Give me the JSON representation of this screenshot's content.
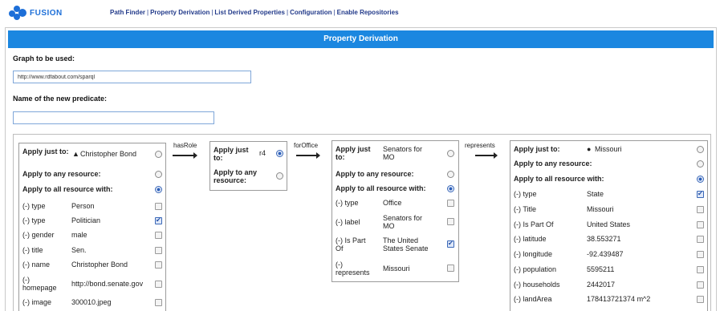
{
  "app": {
    "name": "FUSION",
    "nav": [
      {
        "label": "Path Finder"
      },
      {
        "label": "Property Derivation"
      },
      {
        "label": "List Derived Properties"
      },
      {
        "label": "Configuration"
      },
      {
        "label": "Enable Repositories"
      }
    ],
    "nav_separator": "|",
    "colors": {
      "brand": "#1d6fd8",
      "title_bar": "#1b87e0",
      "nav_link": "#223a8a"
    }
  },
  "panel": {
    "title": "Property Derivation",
    "graph_label": "Graph to be used:",
    "graph_value": "http://www.rdfabout.com/sparql",
    "predicate_label": "Name of the new predicate:",
    "predicate_value": "",
    "predicate_placeholder": ""
  },
  "path": {
    "edges": [
      {
        "label": "hasRole"
      },
      {
        "label": "forOffice"
      },
      {
        "label": "represents"
      }
    ],
    "nodes": [
      {
        "apply_just_label": "Apply just to:",
        "apply_just_value": "Christopher Bond",
        "apply_just_icon": "triangle-icon",
        "apply_any_label": "Apply to any resource:",
        "apply_all_label": "Apply to all resource with:",
        "selected": "all",
        "properties": [
          {
            "key": "(-) type",
            "value": "Person",
            "checked": false
          },
          {
            "key": "(-) type",
            "value": "Politician",
            "checked": true
          },
          {
            "key": "(-) gender",
            "value": "male",
            "checked": false
          },
          {
            "key": "(-) title",
            "value": "Sen.",
            "checked": false
          },
          {
            "key": "(-) name",
            "value": "Christopher Bond",
            "checked": false
          },
          {
            "key": "(-) homepage",
            "value": "http://bond.senate.gov",
            "checked": false
          },
          {
            "key": "(-) image",
            "value": "300010.jpeg",
            "checked": false
          }
        ]
      },
      {
        "apply_just_label": "Apply just to:",
        "apply_just_value": "r4",
        "apply_any_label": "Apply to any resource:",
        "selected": "just",
        "properties": []
      },
      {
        "apply_just_label": "Apply just to:",
        "apply_just_value": "Senators for MO",
        "apply_any_label": "Apply to any resource:",
        "apply_all_label": "Apply to all resource with:",
        "selected": "all",
        "properties": [
          {
            "key": "(-) type",
            "value": "Office",
            "checked": false
          },
          {
            "key": "(-) label",
            "value": "Senators for MO",
            "checked": false
          },
          {
            "key": "(-) Is Part Of",
            "value": "The United States Senate",
            "checked": true
          },
          {
            "key": "(-) represents",
            "value": "Missouri",
            "checked": false
          }
        ]
      },
      {
        "apply_just_label": "Apply just to:",
        "apply_just_value": "Missouri",
        "apply_just_icon": "dot-icon",
        "apply_any_label": "Apply to any resource:",
        "apply_all_label": "Apply to all resource with:",
        "selected": "all",
        "properties": [
          {
            "key": "(-) type",
            "value": "State",
            "checked": true
          },
          {
            "key": "(-) Title",
            "value": "Missouri",
            "checked": false
          },
          {
            "key": "(-) Is Part Of",
            "value": "United States",
            "checked": false
          },
          {
            "key": "(-) latitude",
            "value": "38.553271",
            "checked": false
          },
          {
            "key": "(-) longitude",
            "value": "-92.439487",
            "checked": false
          },
          {
            "key": "(-) population",
            "value": "5595211",
            "checked": false
          },
          {
            "key": "(-) households",
            "value": "2442017",
            "checked": false
          },
          {
            "key": "(-) landArea",
            "value": "178413721374 m^2",
            "checked": false
          }
        ]
      }
    ]
  }
}
